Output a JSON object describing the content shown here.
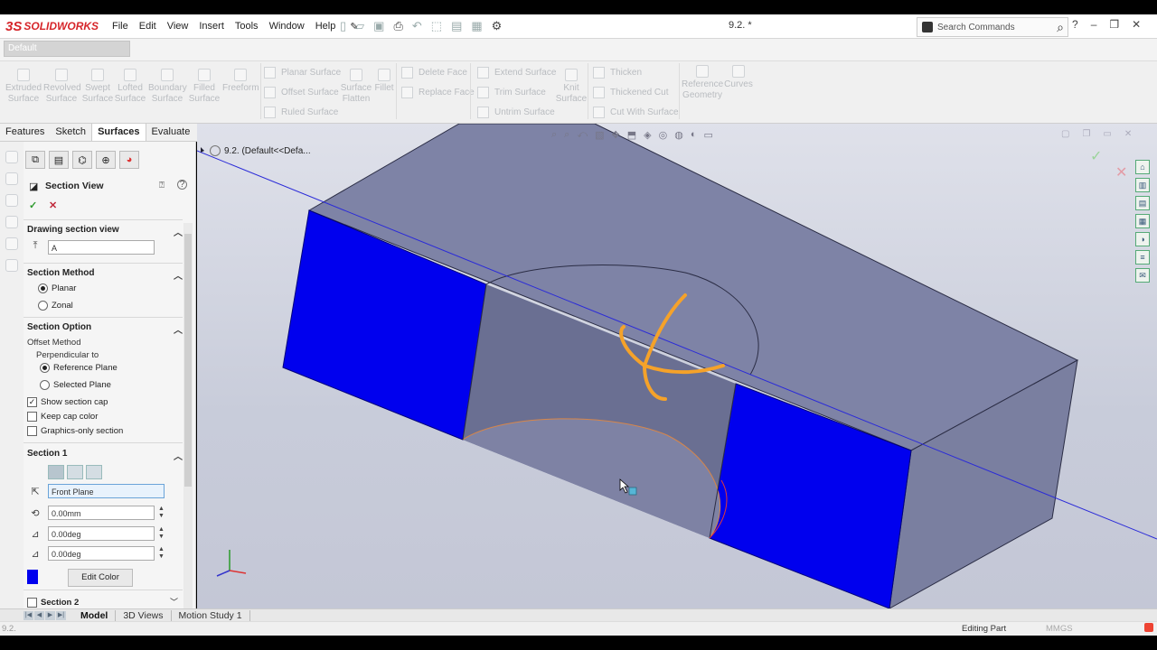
{
  "app": {
    "logo_mark": "3S",
    "logo_text": "SOLIDWORKS",
    "document_title": "9.2. *"
  },
  "menu": [
    "File",
    "Edit",
    "View",
    "Insert",
    "Tools",
    "Window",
    "Help"
  ],
  "search": {
    "placeholder": "Search Commands"
  },
  "window_controls": [
    "?",
    "–",
    "❐",
    "✕"
  ],
  "config": {
    "name": "Default"
  },
  "command_manager": {
    "large_tools": [
      {
        "label": "Extruded\nSurface"
      },
      {
        "label": "Revolved\nSurface"
      },
      {
        "label": "Swept\nSurface"
      },
      {
        "label": "Lofted\nSurface"
      },
      {
        "label": "Boundary\nSurface"
      },
      {
        "label": "Filled\nSurface"
      },
      {
        "label": "Freeform"
      }
    ],
    "group1": [
      "Planar Surface",
      "Offset Surface",
      "Ruled Surface"
    ],
    "flatten": "Surface\nFlatten",
    "fillet": "Fillet",
    "group2": [
      "Delete Face",
      "Replace Face"
    ],
    "group3": [
      "Extend Surface",
      "Trim Surface",
      "Untrim Surface"
    ],
    "knit": "Knit\nSurface",
    "group4": [
      "Thicken",
      "Thickened Cut",
      "Cut With Surface"
    ],
    "ref_geometry": "Reference\nGeometry",
    "curves": "Curves"
  },
  "tabs": [
    "Features",
    "Sketch",
    "Surfaces",
    "Evaluate"
  ],
  "active_tab": "Surfaces",
  "property_manager": {
    "title": "Section View",
    "drawing_section_view": {
      "header": "Drawing section view",
      "name_value": "A"
    },
    "section_method": {
      "header": "Section Method",
      "options": [
        "Planar",
        "Zonal"
      ],
      "selected": "Planar"
    },
    "section_option": {
      "header": "Section Option",
      "offset_method": "Offset Method",
      "perpendicular_to": "Perpendicular to",
      "options": [
        "Reference Plane",
        "Selected Plane"
      ],
      "selected": "Reference Plane",
      "checks": [
        {
          "label": "Show section cap",
          "checked": true
        },
        {
          "label": "Keep cap color",
          "checked": false
        },
        {
          "label": "Graphics-only section",
          "checked": false
        }
      ]
    },
    "section1": {
      "header": "Section 1",
      "plane": "Front Plane",
      "offset": "0.00mm",
      "angle_x": "0.00deg",
      "angle_y": "0.00deg",
      "cap_color": "#0000ee",
      "edit_color_label": "Edit Color"
    },
    "section2": {
      "header": "Section 2",
      "checked": false
    }
  },
  "viewport": {
    "breadcrumb": "9.2.  (Default<<Defa..."
  },
  "bottom_tabs": [
    "Model",
    "3D Views",
    "Motion Study 1"
  ],
  "active_bottom_tab": "Model",
  "status": {
    "left": "9.2.",
    "mode": "Editing Part",
    "units": "MMGS"
  },
  "colors": {
    "section_cap": "#0000ee",
    "body_face": "#7d82a3",
    "triad": "#f5a22a",
    "plane_line": "#2b2bd8"
  }
}
